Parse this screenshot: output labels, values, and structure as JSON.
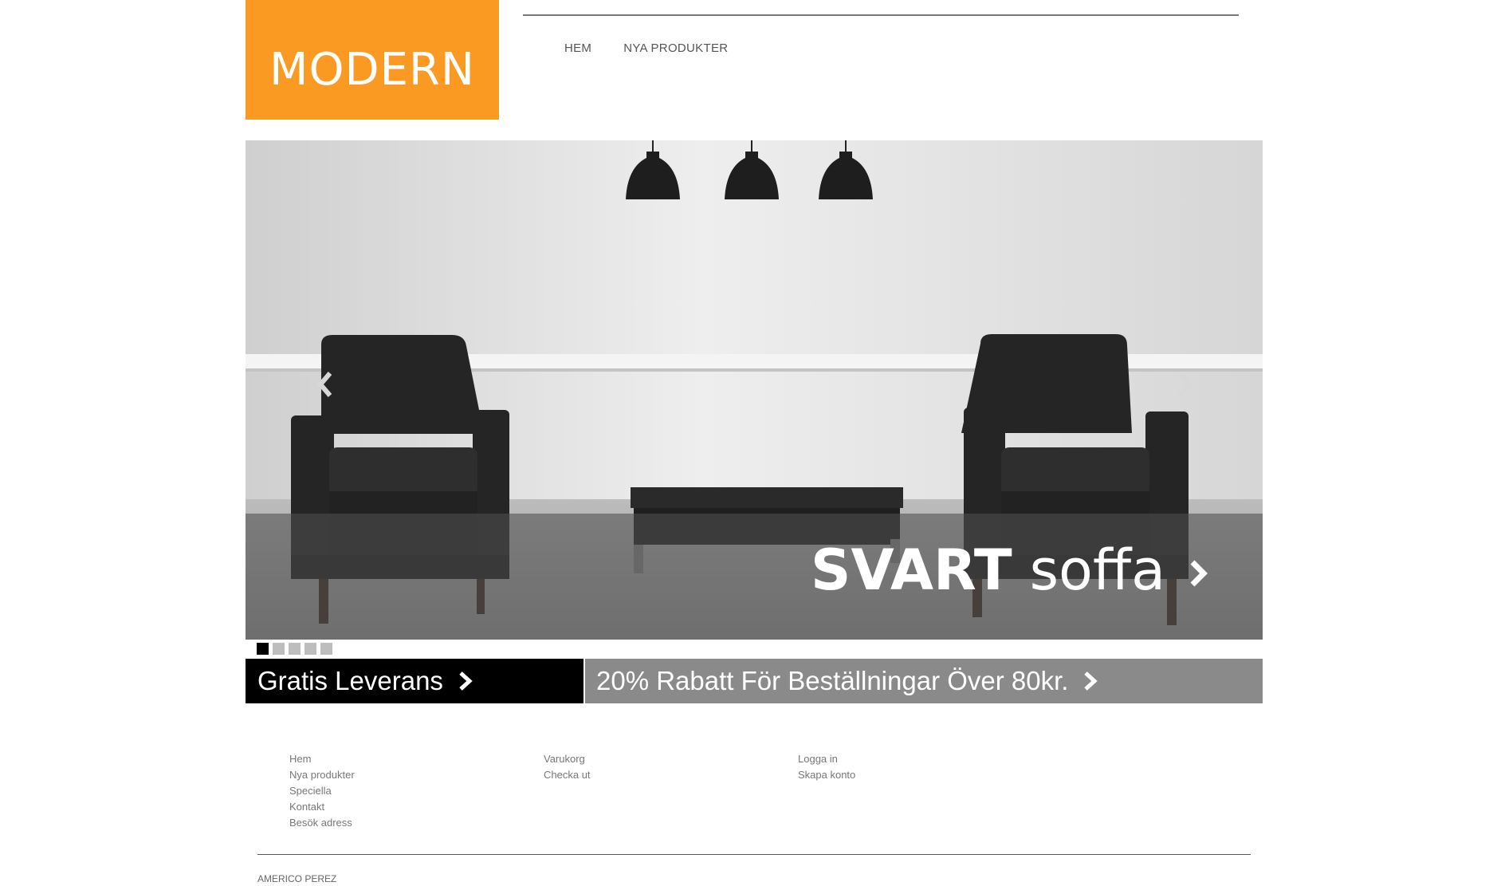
{
  "brand": {
    "logo_text": "MODERN",
    "accent_color": "#fb9a22"
  },
  "nav": {
    "items": [
      "HEM",
      "NYA PRODUKTER"
    ]
  },
  "slider": {
    "caption_bold": "SVART",
    "caption_light": "soffa",
    "prev_icon": "chevron-left-icon",
    "next_icon": "chevron-right-icon",
    "slide_count": 5,
    "active_slide": 1
  },
  "promos": {
    "left_label": "Gratis Leverans",
    "right_label": "20% Rabatt För Beställningar Över 80kr."
  },
  "footer": {
    "col1": [
      "Hem",
      "Nya produkter",
      "Speciella",
      "Kontakt",
      "Besök adress"
    ],
    "col2": [
      "Varukorg",
      "Checka ut"
    ],
    "col3": [
      "Logga in",
      "Skapa konto"
    ],
    "copyright": "AMERICO PEREZ"
  }
}
